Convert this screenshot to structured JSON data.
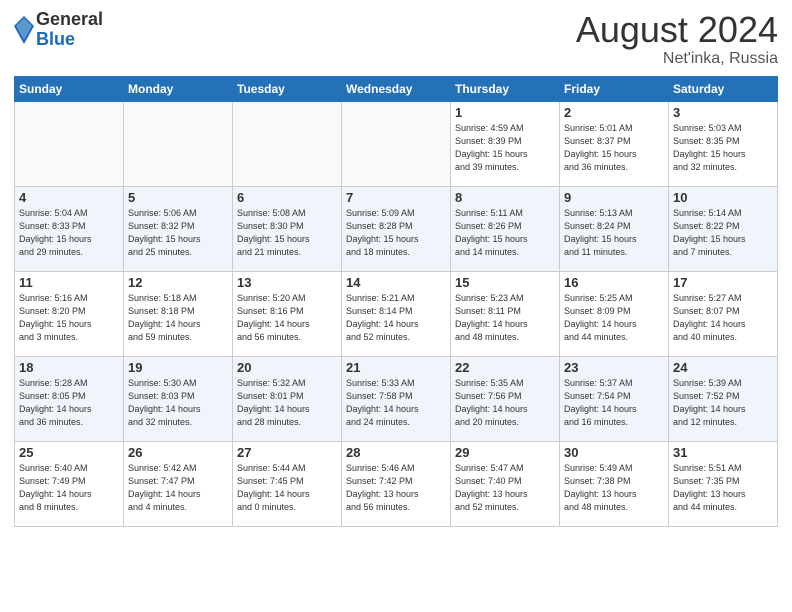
{
  "header": {
    "logo_general": "General",
    "logo_blue": "Blue",
    "month_title": "August 2024",
    "location": "Net'inka, Russia"
  },
  "weekdays": [
    "Sunday",
    "Monday",
    "Tuesday",
    "Wednesday",
    "Thursday",
    "Friday",
    "Saturday"
  ],
  "weeks": [
    [
      {
        "day": "",
        "info": ""
      },
      {
        "day": "",
        "info": ""
      },
      {
        "day": "",
        "info": ""
      },
      {
        "day": "",
        "info": ""
      },
      {
        "day": "1",
        "info": "Sunrise: 4:59 AM\nSunset: 8:39 PM\nDaylight: 15 hours\nand 39 minutes."
      },
      {
        "day": "2",
        "info": "Sunrise: 5:01 AM\nSunset: 8:37 PM\nDaylight: 15 hours\nand 36 minutes."
      },
      {
        "day": "3",
        "info": "Sunrise: 5:03 AM\nSunset: 8:35 PM\nDaylight: 15 hours\nand 32 minutes."
      }
    ],
    [
      {
        "day": "4",
        "info": "Sunrise: 5:04 AM\nSunset: 8:33 PM\nDaylight: 15 hours\nand 29 minutes."
      },
      {
        "day": "5",
        "info": "Sunrise: 5:06 AM\nSunset: 8:32 PM\nDaylight: 15 hours\nand 25 minutes."
      },
      {
        "day": "6",
        "info": "Sunrise: 5:08 AM\nSunset: 8:30 PM\nDaylight: 15 hours\nand 21 minutes."
      },
      {
        "day": "7",
        "info": "Sunrise: 5:09 AM\nSunset: 8:28 PM\nDaylight: 15 hours\nand 18 minutes."
      },
      {
        "day": "8",
        "info": "Sunrise: 5:11 AM\nSunset: 8:26 PM\nDaylight: 15 hours\nand 14 minutes."
      },
      {
        "day": "9",
        "info": "Sunrise: 5:13 AM\nSunset: 8:24 PM\nDaylight: 15 hours\nand 11 minutes."
      },
      {
        "day": "10",
        "info": "Sunrise: 5:14 AM\nSunset: 8:22 PM\nDaylight: 15 hours\nand 7 minutes."
      }
    ],
    [
      {
        "day": "11",
        "info": "Sunrise: 5:16 AM\nSunset: 8:20 PM\nDaylight: 15 hours\nand 3 minutes."
      },
      {
        "day": "12",
        "info": "Sunrise: 5:18 AM\nSunset: 8:18 PM\nDaylight: 14 hours\nand 59 minutes."
      },
      {
        "day": "13",
        "info": "Sunrise: 5:20 AM\nSunset: 8:16 PM\nDaylight: 14 hours\nand 56 minutes."
      },
      {
        "day": "14",
        "info": "Sunrise: 5:21 AM\nSunset: 8:14 PM\nDaylight: 14 hours\nand 52 minutes."
      },
      {
        "day": "15",
        "info": "Sunrise: 5:23 AM\nSunset: 8:11 PM\nDaylight: 14 hours\nand 48 minutes."
      },
      {
        "day": "16",
        "info": "Sunrise: 5:25 AM\nSunset: 8:09 PM\nDaylight: 14 hours\nand 44 minutes."
      },
      {
        "day": "17",
        "info": "Sunrise: 5:27 AM\nSunset: 8:07 PM\nDaylight: 14 hours\nand 40 minutes."
      }
    ],
    [
      {
        "day": "18",
        "info": "Sunrise: 5:28 AM\nSunset: 8:05 PM\nDaylight: 14 hours\nand 36 minutes."
      },
      {
        "day": "19",
        "info": "Sunrise: 5:30 AM\nSunset: 8:03 PM\nDaylight: 14 hours\nand 32 minutes."
      },
      {
        "day": "20",
        "info": "Sunrise: 5:32 AM\nSunset: 8:01 PM\nDaylight: 14 hours\nand 28 minutes."
      },
      {
        "day": "21",
        "info": "Sunrise: 5:33 AM\nSunset: 7:58 PM\nDaylight: 14 hours\nand 24 minutes."
      },
      {
        "day": "22",
        "info": "Sunrise: 5:35 AM\nSunset: 7:56 PM\nDaylight: 14 hours\nand 20 minutes."
      },
      {
        "day": "23",
        "info": "Sunrise: 5:37 AM\nSunset: 7:54 PM\nDaylight: 14 hours\nand 16 minutes."
      },
      {
        "day": "24",
        "info": "Sunrise: 5:39 AM\nSunset: 7:52 PM\nDaylight: 14 hours\nand 12 minutes."
      }
    ],
    [
      {
        "day": "25",
        "info": "Sunrise: 5:40 AM\nSunset: 7:49 PM\nDaylight: 14 hours\nand 8 minutes."
      },
      {
        "day": "26",
        "info": "Sunrise: 5:42 AM\nSunset: 7:47 PM\nDaylight: 14 hours\nand 4 minutes."
      },
      {
        "day": "27",
        "info": "Sunrise: 5:44 AM\nSunset: 7:45 PM\nDaylight: 14 hours\nand 0 minutes."
      },
      {
        "day": "28",
        "info": "Sunrise: 5:46 AM\nSunset: 7:42 PM\nDaylight: 13 hours\nand 56 minutes."
      },
      {
        "day": "29",
        "info": "Sunrise: 5:47 AM\nSunset: 7:40 PM\nDaylight: 13 hours\nand 52 minutes."
      },
      {
        "day": "30",
        "info": "Sunrise: 5:49 AM\nSunset: 7:38 PM\nDaylight: 13 hours\nand 48 minutes."
      },
      {
        "day": "31",
        "info": "Sunrise: 5:51 AM\nSunset: 7:35 PM\nDaylight: 13 hours\nand 44 minutes."
      }
    ]
  ]
}
